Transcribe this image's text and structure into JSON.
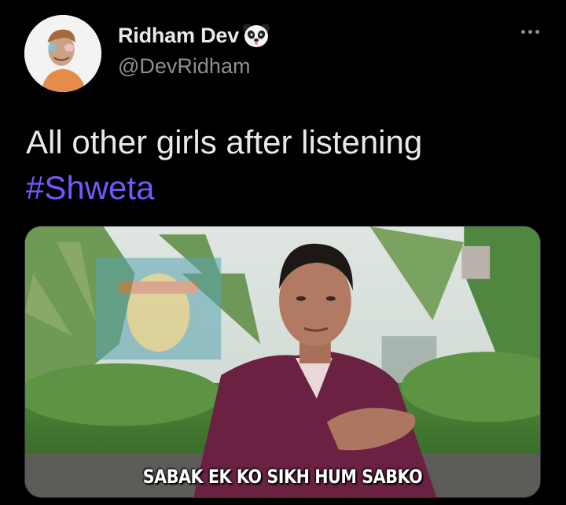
{
  "user": {
    "display_name": "Ridham Dev",
    "handle": "@DevRidham",
    "badge_icon": "panda-icon",
    "avatar_icon": "profile-avatar"
  },
  "tweet": {
    "text": "All other girls after listening",
    "hashtag": "#Shweta"
  },
  "media": {
    "caption": "SABAK EK KO SIKH HUM SABKO"
  },
  "menu": {
    "icon": "more-options-icon"
  },
  "colors": {
    "background": "#000000",
    "text": "#e7e9ea",
    "secondary_text": "#8b9095",
    "hashtag": "#7856ff"
  }
}
